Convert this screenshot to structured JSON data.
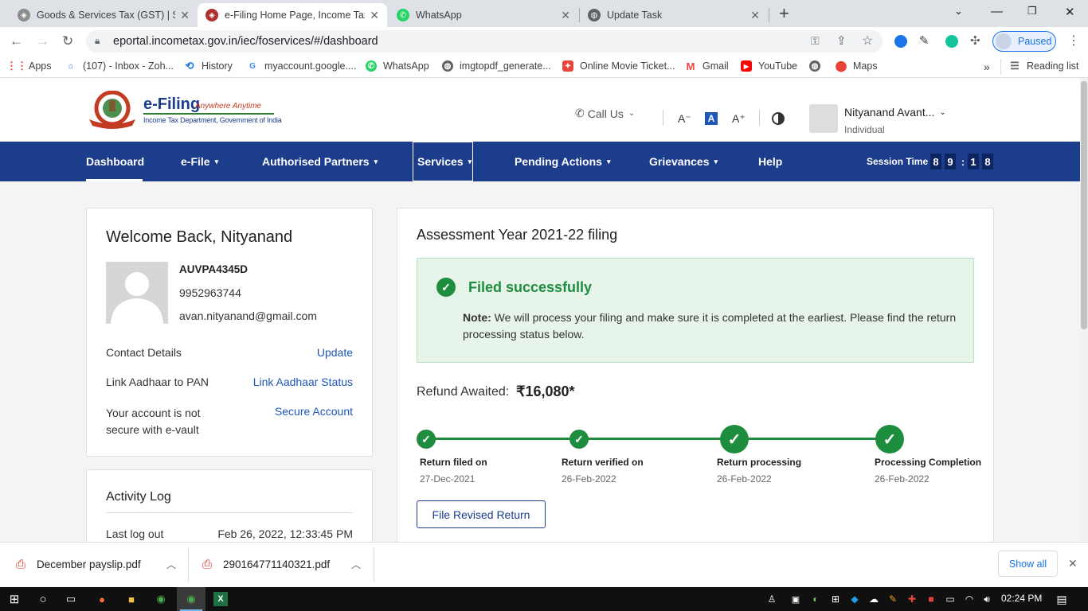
{
  "browser": {
    "tabs": [
      {
        "title": "Goods & Services Tax (GST) | Serv",
        "icon": "gst-emblem-icon"
      },
      {
        "title": "e-Filing Home Page, Income Tax D",
        "icon": "income-tax-emblem-icon",
        "active": true
      },
      {
        "title": "WhatsApp",
        "icon": "whatsapp-icon"
      },
      {
        "title": "Update Task",
        "icon": "globe-icon"
      }
    ],
    "new_tab_glyph": "+",
    "url": "eportal.incometax.gov.in/iec/foservices/#/dashboard",
    "profile_status": "Paused",
    "bookmarks": [
      {
        "label": "Apps",
        "icon": "apps-grid-icon"
      },
      {
        "label": "(107) - Inbox - Zoh...",
        "icon": "zoho-mail-icon"
      },
      {
        "label": "History",
        "icon": "history-icon"
      },
      {
        "label": "myaccount.google....",
        "icon": "google-icon"
      },
      {
        "label": "WhatsApp",
        "icon": "whatsapp-icon"
      },
      {
        "label": "imgtopdf_generate...",
        "icon": "globe-icon"
      },
      {
        "label": "Online Movie Ticket...",
        "icon": "movie-ticket-icon"
      },
      {
        "label": "Gmail",
        "icon": "gmail-icon"
      },
      {
        "label": "YouTube",
        "icon": "youtube-icon"
      },
      {
        "label": "",
        "icon": "globe-icon"
      },
      {
        "label": "Maps",
        "icon": "maps-icon"
      }
    ],
    "bookmarks_overflow": "»",
    "reading_list": "Reading list"
  },
  "site": {
    "logo_title": "e-Filing",
    "logo_tagline": "Anywhere Anytime",
    "logo_subtitle": "Income Tax Department, Government of India",
    "call_us": "Call Us",
    "font_decrease": "A⁻",
    "font_normal": "A",
    "font_increase": "A⁺",
    "user_name": "Nityanand Avant...",
    "user_type": "Individual",
    "nav": [
      {
        "label": "Dashboard",
        "dropdown": false
      },
      {
        "label": "e-File",
        "dropdown": true
      },
      {
        "label": "Authorised Partners",
        "dropdown": true
      },
      {
        "label": "Services",
        "dropdown": true
      },
      {
        "label": "Pending Actions",
        "dropdown": true
      },
      {
        "label": "Grievances",
        "dropdown": true
      },
      {
        "label": "Help",
        "dropdown": false
      }
    ],
    "session_label": "Session Time",
    "session_digits": [
      "8",
      "9",
      ":",
      "1",
      "8"
    ]
  },
  "profile_card": {
    "welcome": "Welcome Back, Nityanand",
    "pan": "AUVPA4345D",
    "phone": "9952963744",
    "email": "avan.nityanand@gmail.com",
    "rows": [
      {
        "label": "Contact Details",
        "action": "Update"
      },
      {
        "label": "Link Aadhaar to PAN",
        "action": "Link Aadhaar Status"
      },
      {
        "label": "Your account is not secure with e-vault",
        "action": "Secure Account"
      }
    ]
  },
  "activity_log": {
    "title": "Activity Log",
    "last_logout_label": "Last log out",
    "last_logout_value": "Feb 26, 2022, 12:33:45 PM"
  },
  "filing_card": {
    "title": "Assessment Year 2021-22 filing",
    "status": "Filed successfully",
    "note_label": "Note:",
    "note_text": " We will process your filing and make sure it is completed at the earliest. Please find the return processing status below.",
    "refund_label": "Refund Awaited:",
    "refund_value": "₹16,080*",
    "steps": [
      {
        "label": "Return filed on",
        "date": "27-Dec-2021"
      },
      {
        "label": "Return verified on",
        "date": "26-Feb-2022"
      },
      {
        "label": "Return processing",
        "date": "26-Feb-2022"
      },
      {
        "label": "Processing Completion",
        "date": "26-Feb-2022"
      }
    ],
    "revised_button": "File Revised Return",
    "accent": "#1e8e3e"
  },
  "downloads": {
    "items": [
      "December payslip.pdf",
      "290164771140321.pdf"
    ],
    "show_all": "Show all"
  },
  "taskbar": {
    "time": "02:24 PM"
  },
  "colors": {
    "nav_bg": "#1c3c8c",
    "link": "#1c56b8",
    "success": "#1e8e3e",
    "success_bg": "#e6f4ea"
  }
}
